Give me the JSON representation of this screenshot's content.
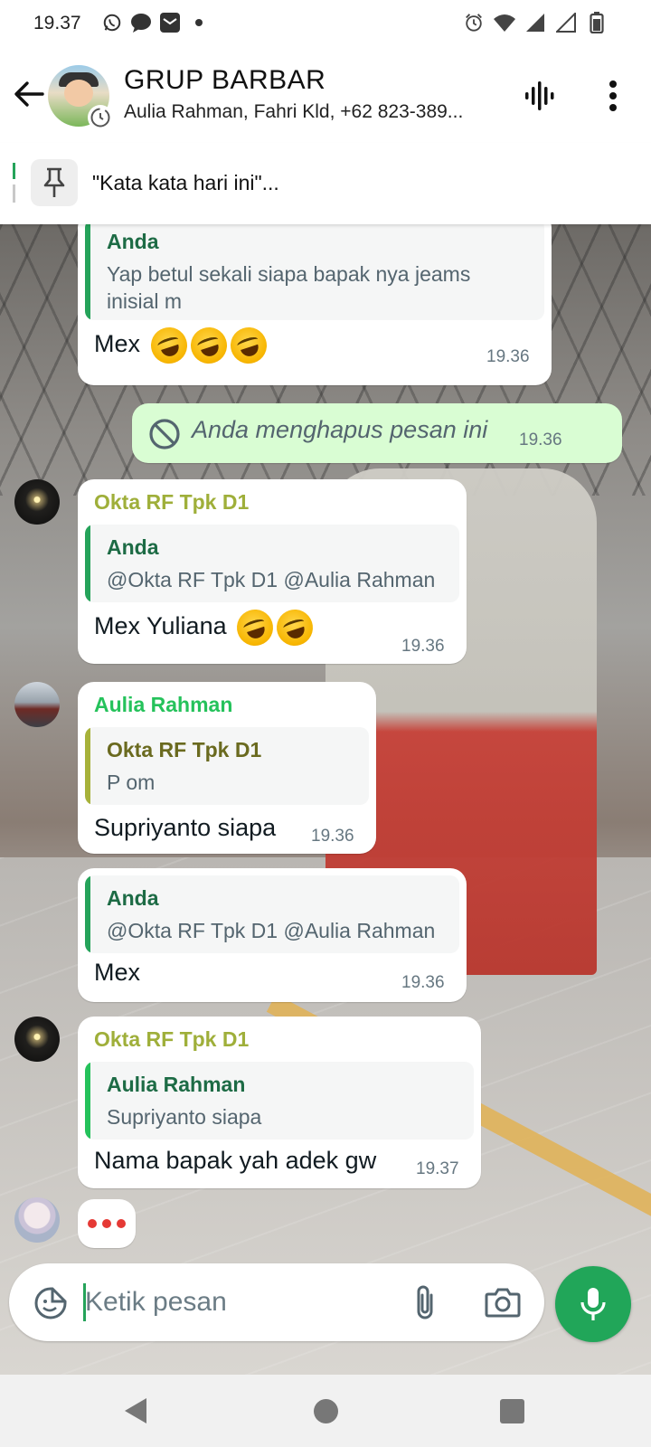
{
  "status_bar": {
    "time": "19.37"
  },
  "header": {
    "title": "GRUP BARBAR",
    "members": "Aulia Rahman, Fahri Kld, +62 823-389..."
  },
  "pinned": {
    "text": "\"Kata kata hari ini\"..."
  },
  "messages": [
    {
      "quote_name": "Anda",
      "quote_text_line1": "Yap betul sekali siapa bapak nya jeams",
      "quote_text_line2": "inisial m",
      "text": "Mex",
      "time": "19.36"
    },
    {
      "text": "Anda menghapus pesan ini",
      "time": "19.36"
    },
    {
      "sender": "Okta RF Tpk D1",
      "quote_name": "Anda",
      "quote_text": "@Okta RF Tpk D1 @Aulia Rahman",
      "text": "Mex Yuliana",
      "time": "19.36"
    },
    {
      "sender": "Aulia Rahman",
      "quote_name": "Okta RF Tpk D1",
      "quote_text": "P om",
      "text": "Supriyanto siapa",
      "time": "19.36"
    },
    {
      "quote_name": "Anda",
      "quote_text": "@Okta RF Tpk D1 @Aulia Rahman",
      "text": "Mex",
      "time": "19.36"
    },
    {
      "sender": "Okta RF Tpk D1",
      "quote_name": "Aulia Rahman",
      "quote_text": "Supriyanto siapa",
      "text": "Nama bapak yah adek gw",
      "time": "19.37"
    }
  ],
  "composer": {
    "placeholder": "Ketik pesan"
  },
  "colors": {
    "okta_name": "#9faf3a",
    "aulia_name": "#25c25b",
    "anda_quote_bar": "#25a35a",
    "okta_quote_bar": "#a7b23a",
    "outgoing_bubble": "#d9fdd3",
    "mic_button": "#21a659"
  },
  "icons": [
    "whatsapp-icon",
    "chat-bubble-icon",
    "mail-icon",
    "alarm-icon",
    "wifi-icon",
    "signal-icon",
    "battery-icon",
    "back-arrow-icon",
    "disappearing-timer-icon",
    "voice-chat-icon",
    "more-vertical-icon",
    "pin-icon",
    "blocked-icon",
    "sticker-icon",
    "paperclip-icon",
    "camera-icon",
    "mic-icon"
  ]
}
